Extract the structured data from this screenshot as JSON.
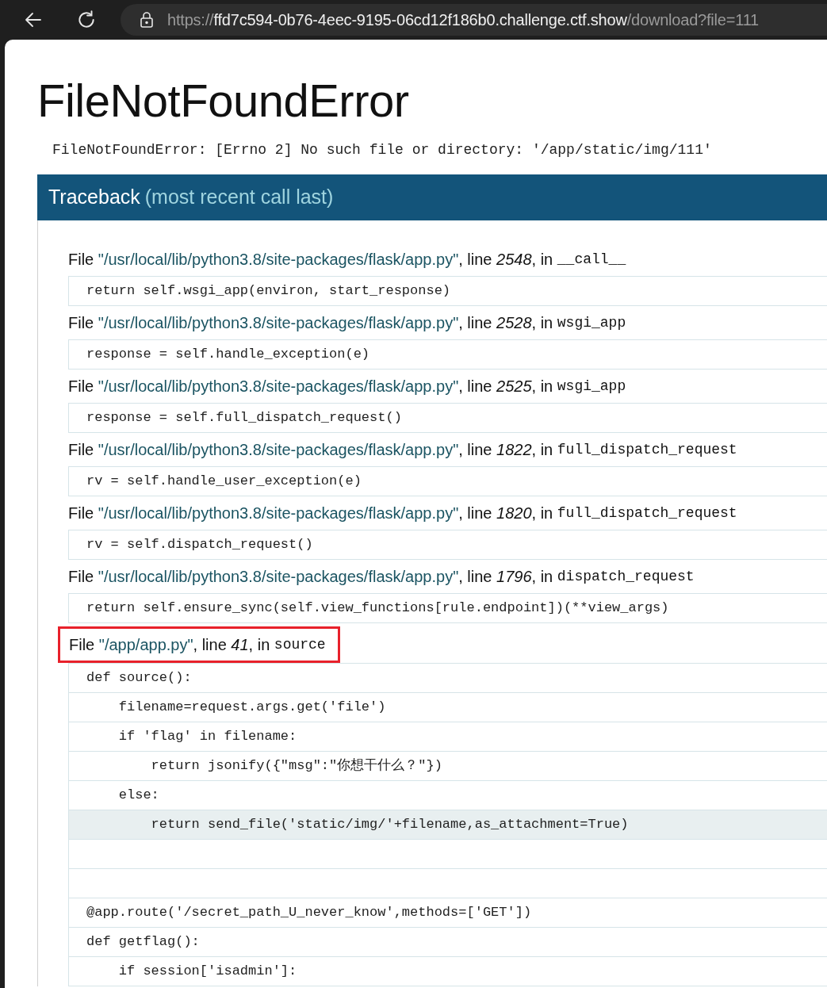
{
  "browser": {
    "url": {
      "scheme": "https://",
      "host": "ffd7c594-0b76-4eec-9195-06cd12f186b0.challenge.ctf.show",
      "path": "/download?file=111"
    }
  },
  "title": "FileNotFoundError",
  "message": "FileNotFoundError: [Errno 2] No such file or directory: '/app/static/img/111'",
  "traceback": {
    "title": "Traceback",
    "subtitle": "(most recent call last)",
    "frames": [
      {
        "file_label": "File",
        "file": "\"/usr/local/lib/python3.8/site-packages/flask/app.py\"",
        "line_label": ", line",
        "line": "2548",
        "in_label": ", in",
        "function": "__call__",
        "highlighted": false,
        "lines": [
          {
            "kind": "code",
            "text": "return self.wsgi_app(environ, start_response)",
            "current": false
          }
        ]
      },
      {
        "file_label": "File",
        "file": "\"/usr/local/lib/python3.8/site-packages/flask/app.py\"",
        "line_label": ", line",
        "line": "2528",
        "in_label": ", in",
        "function": "wsgi_app",
        "highlighted": false,
        "lines": [
          {
            "kind": "code",
            "text": "response = self.handle_exception(e)",
            "current": false
          }
        ]
      },
      {
        "file_label": "File",
        "file": "\"/usr/local/lib/python3.8/site-packages/flask/app.py\"",
        "line_label": ", line",
        "line": "2525",
        "in_label": ", in",
        "function": "wsgi_app",
        "highlighted": false,
        "lines": [
          {
            "kind": "code",
            "text": "response = self.full_dispatch_request()",
            "current": false
          }
        ]
      },
      {
        "file_label": "File",
        "file": "\"/usr/local/lib/python3.8/site-packages/flask/app.py\"",
        "line_label": ", line",
        "line": "1822",
        "in_label": ", in",
        "function": "full_dispatch_request",
        "highlighted": false,
        "lines": [
          {
            "kind": "code",
            "text": "rv = self.handle_user_exception(e)",
            "current": false
          }
        ]
      },
      {
        "file_label": "File",
        "file": "\"/usr/local/lib/python3.8/site-packages/flask/app.py\"",
        "line_label": ", line",
        "line": "1820",
        "in_label": ", in",
        "function": "full_dispatch_request",
        "highlighted": false,
        "lines": [
          {
            "kind": "code",
            "text": "rv = self.dispatch_request()",
            "current": false
          }
        ]
      },
      {
        "file_label": "File",
        "file": "\"/usr/local/lib/python3.8/site-packages/flask/app.py\"",
        "line_label": ", line",
        "line": "1796",
        "in_label": ", in",
        "function": "dispatch_request",
        "highlighted": false,
        "lines": [
          {
            "kind": "code",
            "text": "return self.ensure_sync(self.view_functions[rule.endpoint])(**view_args)",
            "current": false
          }
        ]
      },
      {
        "file_label": "File",
        "file": "\"/app/app.py\"",
        "line_label": ", line",
        "line": "41",
        "in_label": ", in",
        "function": "source",
        "highlighted": true,
        "lines": [
          {
            "kind": "code",
            "text": "def source():",
            "current": false
          },
          {
            "kind": "code",
            "text": "    filename=request.args.get('file')",
            "current": false
          },
          {
            "kind": "code",
            "text": "    if 'flag' in filename:",
            "current": false
          },
          {
            "kind": "code",
            "text": "        return jsonify({\"msg\":\"你想干什么？\"})",
            "current": false
          },
          {
            "kind": "code",
            "text": "    else:",
            "current": false
          },
          {
            "kind": "code",
            "text": "        return send_file('static/img/'+filename,as_attachment=True)",
            "current": true
          },
          {
            "kind": "blank",
            "current": false
          },
          {
            "kind": "blank",
            "current": false
          },
          {
            "kind": "code",
            "text": "@app.route('/secret_path_U_never_know',methods=['GET'])",
            "current": false
          },
          {
            "kind": "code",
            "text": "def getflag():",
            "current": false
          },
          {
            "kind": "code",
            "text": "    if session['isadmin']:",
            "current": false
          }
        ]
      }
    ]
  }
}
